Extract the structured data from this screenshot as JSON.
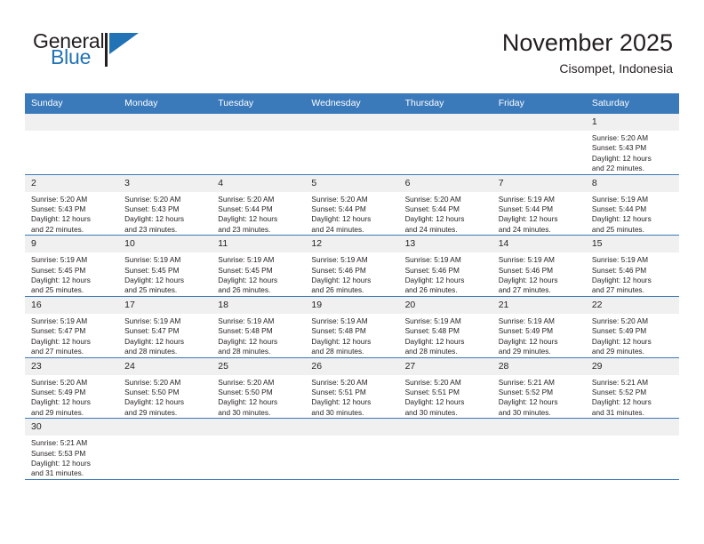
{
  "brand": {
    "name_top": "General",
    "name_bottom": "Blue",
    "logo_icon": "triangle-logo-icon",
    "accent_color": "#2272b6"
  },
  "header": {
    "title": "November 2025",
    "subtitle": "Cisompet, Indonesia"
  },
  "calendar": {
    "header_bg": "#3a79ba",
    "daynum_bg": "#f0f0f0",
    "weekday_headers": [
      "Sunday",
      "Monday",
      "Tuesday",
      "Wednesday",
      "Thursday",
      "Friday",
      "Saturday"
    ],
    "weeks": [
      [
        {
          "day": "",
          "lines": []
        },
        {
          "day": "",
          "lines": []
        },
        {
          "day": "",
          "lines": []
        },
        {
          "day": "",
          "lines": []
        },
        {
          "day": "",
          "lines": []
        },
        {
          "day": "",
          "lines": []
        },
        {
          "day": "1",
          "lines": [
            "Sunrise: 5:20 AM",
            "Sunset: 5:43 PM",
            "Daylight: 12 hours",
            "and 22 minutes."
          ]
        }
      ],
      [
        {
          "day": "2",
          "lines": [
            "Sunrise: 5:20 AM",
            "Sunset: 5:43 PM",
            "Daylight: 12 hours",
            "and 22 minutes."
          ]
        },
        {
          "day": "3",
          "lines": [
            "Sunrise: 5:20 AM",
            "Sunset: 5:43 PM",
            "Daylight: 12 hours",
            "and 23 minutes."
          ]
        },
        {
          "day": "4",
          "lines": [
            "Sunrise: 5:20 AM",
            "Sunset: 5:44 PM",
            "Daylight: 12 hours",
            "and 23 minutes."
          ]
        },
        {
          "day": "5",
          "lines": [
            "Sunrise: 5:20 AM",
            "Sunset: 5:44 PM",
            "Daylight: 12 hours",
            "and 24 minutes."
          ]
        },
        {
          "day": "6",
          "lines": [
            "Sunrise: 5:20 AM",
            "Sunset: 5:44 PM",
            "Daylight: 12 hours",
            "and 24 minutes."
          ]
        },
        {
          "day": "7",
          "lines": [
            "Sunrise: 5:19 AM",
            "Sunset: 5:44 PM",
            "Daylight: 12 hours",
            "and 24 minutes."
          ]
        },
        {
          "day": "8",
          "lines": [
            "Sunrise: 5:19 AM",
            "Sunset: 5:44 PM",
            "Daylight: 12 hours",
            "and 25 minutes."
          ]
        }
      ],
      [
        {
          "day": "9",
          "lines": [
            "Sunrise: 5:19 AM",
            "Sunset: 5:45 PM",
            "Daylight: 12 hours",
            "and 25 minutes."
          ]
        },
        {
          "day": "10",
          "lines": [
            "Sunrise: 5:19 AM",
            "Sunset: 5:45 PM",
            "Daylight: 12 hours",
            "and 25 minutes."
          ]
        },
        {
          "day": "11",
          "lines": [
            "Sunrise: 5:19 AM",
            "Sunset: 5:45 PM",
            "Daylight: 12 hours",
            "and 26 minutes."
          ]
        },
        {
          "day": "12",
          "lines": [
            "Sunrise: 5:19 AM",
            "Sunset: 5:46 PM",
            "Daylight: 12 hours",
            "and 26 minutes."
          ]
        },
        {
          "day": "13",
          "lines": [
            "Sunrise: 5:19 AM",
            "Sunset: 5:46 PM",
            "Daylight: 12 hours",
            "and 26 minutes."
          ]
        },
        {
          "day": "14",
          "lines": [
            "Sunrise: 5:19 AM",
            "Sunset: 5:46 PM",
            "Daylight: 12 hours",
            "and 27 minutes."
          ]
        },
        {
          "day": "15",
          "lines": [
            "Sunrise: 5:19 AM",
            "Sunset: 5:46 PM",
            "Daylight: 12 hours",
            "and 27 minutes."
          ]
        }
      ],
      [
        {
          "day": "16",
          "lines": [
            "Sunrise: 5:19 AM",
            "Sunset: 5:47 PM",
            "Daylight: 12 hours",
            "and 27 minutes."
          ]
        },
        {
          "day": "17",
          "lines": [
            "Sunrise: 5:19 AM",
            "Sunset: 5:47 PM",
            "Daylight: 12 hours",
            "and 28 minutes."
          ]
        },
        {
          "day": "18",
          "lines": [
            "Sunrise: 5:19 AM",
            "Sunset: 5:48 PM",
            "Daylight: 12 hours",
            "and 28 minutes."
          ]
        },
        {
          "day": "19",
          "lines": [
            "Sunrise: 5:19 AM",
            "Sunset: 5:48 PM",
            "Daylight: 12 hours",
            "and 28 minutes."
          ]
        },
        {
          "day": "20",
          "lines": [
            "Sunrise: 5:19 AM",
            "Sunset: 5:48 PM",
            "Daylight: 12 hours",
            "and 28 minutes."
          ]
        },
        {
          "day": "21",
          "lines": [
            "Sunrise: 5:19 AM",
            "Sunset: 5:49 PM",
            "Daylight: 12 hours",
            "and 29 minutes."
          ]
        },
        {
          "day": "22",
          "lines": [
            "Sunrise: 5:20 AM",
            "Sunset: 5:49 PM",
            "Daylight: 12 hours",
            "and 29 minutes."
          ]
        }
      ],
      [
        {
          "day": "23",
          "lines": [
            "Sunrise: 5:20 AM",
            "Sunset: 5:49 PM",
            "Daylight: 12 hours",
            "and 29 minutes."
          ]
        },
        {
          "day": "24",
          "lines": [
            "Sunrise: 5:20 AM",
            "Sunset: 5:50 PM",
            "Daylight: 12 hours",
            "and 29 minutes."
          ]
        },
        {
          "day": "25",
          "lines": [
            "Sunrise: 5:20 AM",
            "Sunset: 5:50 PM",
            "Daylight: 12 hours",
            "and 30 minutes."
          ]
        },
        {
          "day": "26",
          "lines": [
            "Sunrise: 5:20 AM",
            "Sunset: 5:51 PM",
            "Daylight: 12 hours",
            "and 30 minutes."
          ]
        },
        {
          "day": "27",
          "lines": [
            "Sunrise: 5:20 AM",
            "Sunset: 5:51 PM",
            "Daylight: 12 hours",
            "and 30 minutes."
          ]
        },
        {
          "day": "28",
          "lines": [
            "Sunrise: 5:21 AM",
            "Sunset: 5:52 PM",
            "Daylight: 12 hours",
            "and 30 minutes."
          ]
        },
        {
          "day": "29",
          "lines": [
            "Sunrise: 5:21 AM",
            "Sunset: 5:52 PM",
            "Daylight: 12 hours",
            "and 31 minutes."
          ]
        }
      ],
      [
        {
          "day": "30",
          "lines": [
            "Sunrise: 5:21 AM",
            "Sunset: 5:53 PM",
            "Daylight: 12 hours",
            "and 31 minutes."
          ]
        },
        {
          "day": "",
          "lines": []
        },
        {
          "day": "",
          "lines": []
        },
        {
          "day": "",
          "lines": []
        },
        {
          "day": "",
          "lines": []
        },
        {
          "day": "",
          "lines": []
        },
        {
          "day": "",
          "lines": []
        }
      ]
    ]
  }
}
